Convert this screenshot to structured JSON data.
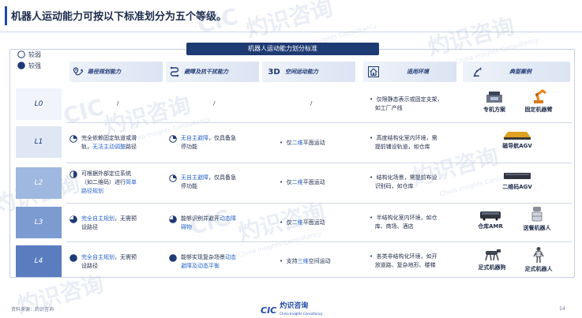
{
  "title": "机器人运动能力可按以下标准划分为五个等级。",
  "table_title": "机器人运动能力划分标准",
  "legend": {
    "weak": "较弱",
    "strong": "较强"
  },
  "columns": [
    {
      "icon": "route-planning-icon",
      "label": "路径规划能力"
    },
    {
      "icon": "obstacle-avoidance-icon",
      "label": "避障及抗干扰能力"
    },
    {
      "icon": "3d-space-icon",
      "label": "空间运动能力"
    },
    {
      "icon": "environment-house-icon",
      "label": "适用环境"
    },
    {
      "icon": "robot-arm-icon",
      "label": "典型案例"
    }
  ],
  "levels": [
    {
      "level": "L0",
      "path": "/",
      "avoid": "/",
      "space": "/",
      "env": [
        "仅限静态表示或固定支架，",
        "如工厂产线"
      ],
      "cases": [
        "专机方案",
        "固定机器臂"
      ]
    },
    {
      "level": "L1",
      "path": [
        "完全依赖固定轨道或滑",
        "轨，",
        "无法主动调整",
        "路径"
      ],
      "avoid": [
        "无自主避障",
        "，仅具备急",
        "停功能"
      ],
      "space": [
        "仅",
        "二维",
        "平面运动"
      ],
      "env": [
        "高度结构化室内环境，需",
        "提前铺设轨道，如仓库"
      ],
      "cases": [
        "磁导航AGV"
      ]
    },
    {
      "level": "L2",
      "path": [
        "可根据外部定位系统",
        "（如二维码）进行",
        "简单",
        "路径规划"
      ],
      "avoid": [
        "无自主避障",
        "，仅具备急",
        "停功能"
      ],
      "space": [
        "仅",
        "二维",
        "平面运动"
      ],
      "env": [
        "结构化场景，需提前布设",
        "识别码，如仓库"
      ],
      "cases": [
        "二维码AGV"
      ]
    },
    {
      "level": "L3",
      "path": [
        "完全自主规划",
        "，无需预",
        "设路径"
      ],
      "avoid": [
        "能够识别并避开",
        "动态障",
        "碍物"
      ],
      "space": [
        "仅",
        "二维",
        "平面运动"
      ],
      "env": [
        "半结构化室内环境，如仓",
        "库、商场、酒店"
      ],
      "cases": [
        "仓库AMR",
        "送餐机器人"
      ]
    },
    {
      "level": "L4",
      "path": [
        "完全自主规划",
        "，无需预",
        "设路径"
      ],
      "avoid": [
        "能够实现复杂场景",
        "动态",
        "避障及动态平衡"
      ],
      "space": [
        "支持",
        "三维",
        "空间运动"
      ],
      "env": [
        "各类非结构化环境，如开",
        "放道路、复杂地形、楼梯"
      ],
      "cases": [
        "足式机器狗",
        "足式机器人"
      ]
    }
  ],
  "watermark": {
    "logo": "CIC",
    "cn": "灼识咨询",
    "en": "China Insights Consultancy"
  },
  "footer": {
    "source": "资料来源：灼识咨询",
    "page": "14"
  },
  "colors": {
    "accent": "#1f4aa8",
    "header_dark": "#1e3a72",
    "highlight": "#2a64c9"
  }
}
